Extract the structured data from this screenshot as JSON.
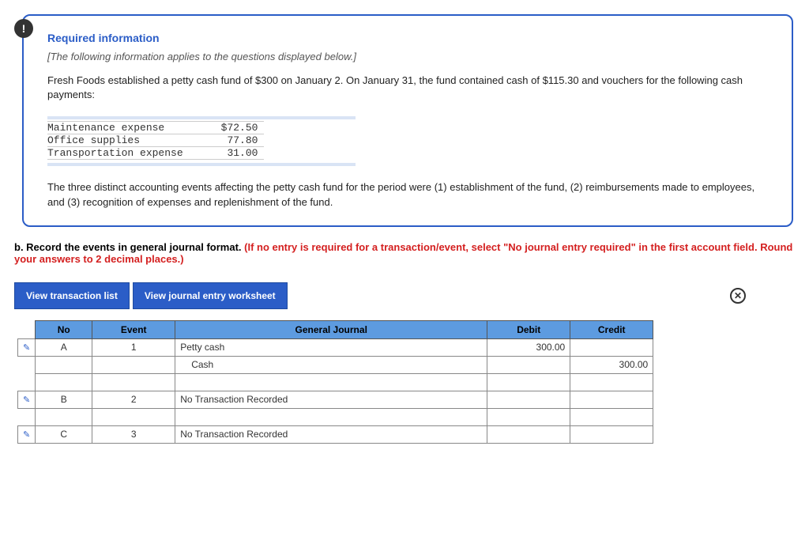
{
  "alert_icon": "!",
  "info": {
    "title": "Required information",
    "subtitle": "[The following information applies to the questions displayed below.]",
    "body1": "Fresh Foods established a petty cash fund of $300 on January 2. On January 31, the fund contained cash of $115.30 and vouchers for the following cash payments:",
    "vouchers": [
      {
        "label": "Maintenance expense",
        "amount": "$72.50"
      },
      {
        "label": "Office supplies",
        "amount": "77.80"
      },
      {
        "label": "Transportation expense",
        "amount": "31.00"
      }
    ],
    "body2": "The three distinct accounting events affecting the petty cash fund for the period were (1) establishment of the fund, (2) reimbursements made to employees, and (3) recognition of expenses and replenishment of the fund."
  },
  "question": {
    "part_black": "b. Record the events in general journal format. ",
    "part_red": "(If no entry is required for a transaction/event, select \"No journal entry required\" in the first account field. Round your answers to 2 decimal places.)"
  },
  "tabs": {
    "view_list": "View transaction list",
    "view_worksheet": "View journal entry worksheet"
  },
  "close_icon": "✕",
  "journal": {
    "headers": {
      "no": "No",
      "event": "Event",
      "gj": "General Journal",
      "debit": "Debit",
      "credit": "Credit"
    },
    "rows": [
      {
        "pencil": true,
        "no": "A",
        "event": "1",
        "gj": "Petty cash",
        "gj_indent": 0,
        "debit": "300.00",
        "credit": ""
      },
      {
        "pencil": false,
        "no": "",
        "event": "",
        "gj": "Cash",
        "gj_indent": 1,
        "debit": "",
        "credit": "300.00"
      },
      {
        "pencil": false,
        "no": "",
        "event": "",
        "gj": "",
        "gj_indent": 0,
        "debit": "",
        "credit": ""
      },
      {
        "pencil": true,
        "no": "B",
        "event": "2",
        "gj": "No Transaction Recorded",
        "gj_indent": 0,
        "debit": "",
        "credit": ""
      },
      {
        "pencil": false,
        "no": "",
        "event": "",
        "gj": "",
        "gj_indent": 0,
        "debit": "",
        "credit": ""
      },
      {
        "pencil": true,
        "no": "C",
        "event": "3",
        "gj": "No Transaction Recorded",
        "gj_indent": 0,
        "debit": "",
        "credit": ""
      }
    ]
  }
}
